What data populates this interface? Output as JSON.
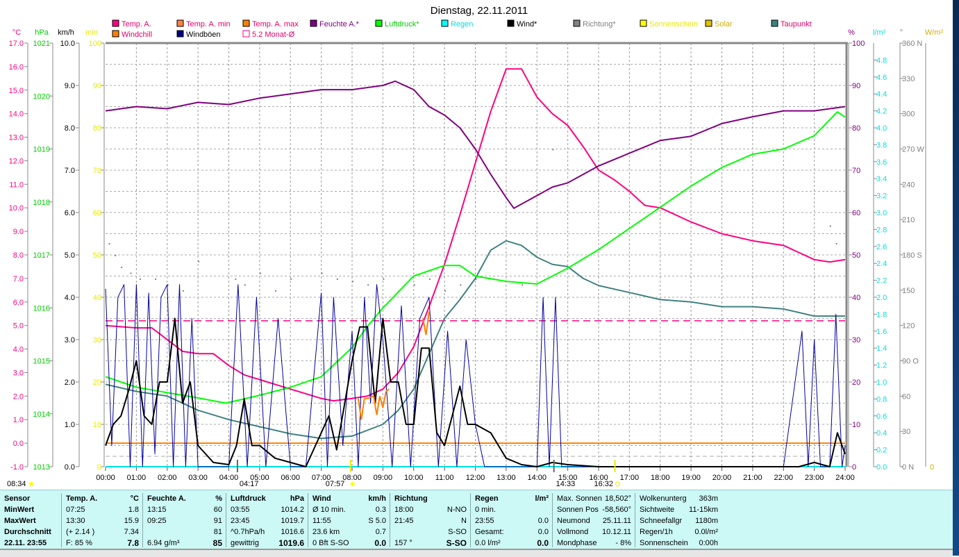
{
  "title": "Dienstag, 22.11.2011",
  "legend": [
    {
      "label": "Temp. A.",
      "color": "#ff0080",
      "text": "#e0006a"
    },
    {
      "label": "Temp. A. min",
      "color": "#ff8040",
      "text": "#e0006a"
    },
    {
      "label": "Temp. A. max",
      "color": "#ff8000",
      "text": "#e0006a"
    },
    {
      "label": "Feuchte A.*",
      "color": "#800080",
      "text": "#800080"
    },
    {
      "label": "Luftdruck*",
      "color": "#00ff00",
      "text": "#00cc00"
    },
    {
      "label": "Regen",
      "color": "#00ffff",
      "text": "#00e0e0"
    },
    {
      "label": "Wind*",
      "color": "#000000",
      "text": "#000000"
    },
    {
      "label": "Richtung*",
      "color": "#808080",
      "text": "#808080"
    },
    {
      "label": "Sonnenschein",
      "color": "#ffff00",
      "text": "#e8e800"
    },
    {
      "label": "Solar",
      "color": "#e0c000",
      "text": "#d0b000"
    },
    {
      "label": "Taupunkt",
      "color": "#408080",
      "text": "#e0006a"
    },
    {
      "label": "Windchill",
      "color": "#ff8000",
      "text": "#e0006a"
    },
    {
      "label": "Windböen",
      "color": "#000080",
      "text": "#000000"
    },
    {
      "label": "5.2 Monat-Ø",
      "color": "#ff0080",
      "text": "#e0006a",
      "outline": true
    }
  ],
  "chart_data": {
    "type": "line",
    "title": "Dienstag, 22.11.2011",
    "x_unit": "hours",
    "xlim": [
      0,
      24
    ],
    "x_ticks": [
      "00:00",
      "01:00",
      "02:00",
      "03:00",
      "04:00",
      "05:00",
      "06:00",
      "07:00",
      "08:00",
      "09:00",
      "10:00",
      "11:00",
      "12:00",
      "13:00",
      "14:00",
      "15:00",
      "16:00",
      "17:00",
      "18:00",
      "19:00",
      "20:00",
      "21:00",
      "22:00",
      "23:00",
      "24:00"
    ],
    "axes": {
      "temp": {
        "unit": "°C",
        "min": -1,
        "max": 17,
        "step": 1,
        "decimals": 1,
        "color": "#ff0080"
      },
      "press": {
        "unit": "hPa",
        "min": 1013,
        "max": 1021,
        "step": 1,
        "decimals": 0,
        "color": "#00cc00"
      },
      "wind": {
        "unit": "km/h",
        "min": 0,
        "max": 10,
        "step": 1,
        "decimals": 1,
        "color": "#000000"
      },
      "sunmin": {
        "unit": "min",
        "min": 0,
        "max": 100,
        "step": 10,
        "decimals": 0,
        "color": "#e8e800"
      },
      "hum": {
        "unit": "%",
        "min": 0,
        "max": 100,
        "step": 10,
        "decimals": 0,
        "color": "#800080"
      },
      "rain": {
        "unit": "l/m²",
        "min": 0,
        "max": 5,
        "step": 0.2,
        "decimals": 1,
        "color": "#00e0e0",
        "skipTop": true
      },
      "dir": {
        "unit": "°",
        "min": 0,
        "max": 360,
        "step": 30,
        "decimals": 0,
        "color": "#808080",
        "suffix": {
          "360": " N",
          "270": " W",
          "180": " S",
          "90": "  O",
          "0": "   N"
        }
      },
      "solar": {
        "unit": "W/m²",
        "min": 0,
        "max": 0,
        "color": "#d0b000"
      }
    },
    "series": [
      {
        "name": "Temp. A.",
        "axis": "temp",
        "color": "#ff0080",
        "width": 2,
        "x": [
          0,
          1,
          1.5,
          2,
          2.5,
          3,
          3.5,
          4,
          4.5,
          5,
          6,
          7,
          7.4,
          8,
          8.5,
          9,
          9.5,
          10,
          10.5,
          11,
          11.5,
          12,
          12.5,
          13,
          13.5,
          14,
          14.5,
          15,
          15.5,
          16,
          16.5,
          17,
          17.5,
          18,
          19,
          20,
          21,
          22,
          23,
          23.5,
          24
        ],
        "y": [
          5.0,
          4.9,
          4.9,
          4.4,
          3.9,
          3.8,
          3.8,
          3.3,
          2.9,
          2.7,
          2.3,
          1.9,
          1.8,
          1.9,
          2.0,
          2.3,
          3.0,
          4.1,
          5.8,
          7.6,
          9.7,
          11.9,
          14.1,
          15.9,
          15.9,
          14.7,
          14.0,
          13.5,
          12.6,
          11.6,
          11.2,
          10.7,
          10.1,
          10.0,
          9.4,
          8.9,
          8.6,
          8.4,
          7.8,
          7.7,
          7.8
        ]
      },
      {
        "name": "Taupunkt",
        "axis": "temp",
        "color": "#408080",
        "width": 2,
        "x": [
          0,
          1,
          2,
          3,
          4,
          5,
          6,
          7,
          8,
          9,
          9.5,
          10,
          10.5,
          11,
          11.5,
          12,
          12.5,
          13,
          13.5,
          14,
          14.5,
          15,
          15.5,
          16,
          17,
          18,
          19,
          20,
          21,
          22,
          23,
          24
        ],
        "y": [
          2.5,
          2.2,
          2.0,
          1.4,
          1.0,
          0.7,
          0.4,
          0.2,
          0.3,
          0.8,
          1.4,
          2.3,
          3.8,
          5.3,
          6.1,
          7.0,
          8.2,
          8.6,
          8.4,
          7.9,
          7.6,
          7.5,
          7.0,
          6.7,
          6.4,
          6.1,
          6.0,
          5.8,
          5.8,
          5.7,
          5.4,
          5.4
        ]
      },
      {
        "name": "Feuchte A.",
        "axis": "hum",
        "color": "#800080",
        "width": 2,
        "x": [
          0,
          1,
          2,
          3,
          4,
          5,
          6,
          7,
          8,
          9,
          9.4,
          10,
          10.5,
          11,
          11.5,
          12,
          12.5,
          13,
          13.25,
          14,
          14.5,
          15,
          16,
          17,
          18,
          19,
          20,
          21,
          22,
          23,
          24
        ],
        "y": [
          84,
          85,
          84.5,
          86,
          85.5,
          87,
          88,
          89,
          89,
          90,
          91,
          89,
          85,
          83,
          80,
          75,
          69,
          63.5,
          61,
          64,
          66,
          67,
          71,
          74,
          77,
          78,
          81,
          82.6,
          84,
          84,
          85
        ]
      },
      {
        "name": "Luftdruck",
        "axis": "press",
        "color": "#00ff00",
        "width": 2,
        "x": [
          0,
          1,
          2,
          3,
          3.9,
          5,
          6,
          7,
          8,
          8.5,
          9,
          10,
          11,
          11.5,
          12,
          13,
          14,
          15,
          16,
          17,
          18,
          19,
          20,
          21,
          22,
          23,
          23.75,
          24
        ],
        "y": [
          1014.7,
          1014.5,
          1014.4,
          1014.3,
          1014.2,
          1014.35,
          1014.5,
          1014.7,
          1015.25,
          1015.65,
          1016.0,
          1016.6,
          1016.8,
          1016.8,
          1016.6,
          1016.5,
          1016.45,
          1016.75,
          1017.1,
          1017.5,
          1017.9,
          1018.3,
          1018.65,
          1018.9,
          1019.0,
          1019.25,
          1019.7,
          1019.6
        ]
      },
      {
        "name": "Windböen",
        "axis": "wind",
        "color": "#0000a0",
        "width": 1,
        "x": [
          0,
          0.2,
          0.4,
          0.6,
          0.8,
          1.0,
          1.2,
          1.4,
          1.6,
          1.8,
          2.0,
          2.2,
          2.4,
          2.6,
          2.8,
          3.0,
          3.5,
          4.0,
          4.3,
          4.6,
          4.9,
          5.2,
          5.6,
          6.0,
          6.5,
          7.0,
          7.2,
          7.4,
          7.7,
          8.0,
          8.2,
          8.4,
          8.6,
          8.8,
          9.0,
          9.3,
          9.6,
          9.9,
          10.2,
          10.5,
          10.8,
          11.1,
          11.4,
          11.7,
          12.0,
          12.3,
          12.6,
          12.9,
          13.5,
          14.0,
          14.2,
          14.4,
          14.6,
          14.8,
          15.0,
          16,
          18,
          20,
          22,
          22.6,
          22.8,
          23.0,
          23.2,
          23.5,
          23.7,
          23.9,
          24
        ],
        "y": [
          4.2,
          0.5,
          4.0,
          4.3,
          0,
          4.3,
          0,
          4.1,
          0.3,
          4.0,
          4.3,
          0,
          4.3,
          0,
          3.5,
          0,
          0,
          0,
          4.3,
          0,
          4.0,
          0,
          3.5,
          0,
          0,
          4.1,
          0,
          4.0,
          0.5,
          3.2,
          0,
          4.0,
          1.5,
          4.3,
          3.0,
          0,
          3.8,
          0,
          3.5,
          4.0,
          0,
          3.2,
          0,
          3.0,
          1.0,
          0,
          0,
          0,
          0,
          0,
          4.0,
          0,
          4.0,
          0,
          0,
          0,
          0,
          0,
          0,
          3.2,
          0,
          3.0,
          0,
          0,
          3.6,
          0,
          0.5
        ]
      },
      {
        "name": "Wind",
        "axis": "wind",
        "color": "#000000",
        "width": 2,
        "x": [
          0,
          0.25,
          0.5,
          0.75,
          1,
          1.25,
          1.5,
          1.75,
          2,
          2.25,
          2.5,
          2.75,
          3,
          3.5,
          4,
          4.25,
          4.5,
          4.75,
          5,
          5.5,
          6,
          6.5,
          7,
          7.25,
          7.5,
          8,
          8.25,
          8.5,
          8.75,
          9,
          9.25,
          9.5,
          9.75,
          10,
          10.25,
          10.5,
          10.75,
          11,
          11.5,
          11.75,
          12,
          12.5,
          13,
          13.5,
          14,
          14.5,
          15,
          16,
          20,
          22.5,
          23,
          23.5,
          23.75,
          24
        ],
        "y": [
          0.5,
          1.0,
          1.2,
          1.8,
          2.5,
          1.2,
          1.0,
          2.0,
          2.0,
          3.5,
          1.5,
          2.0,
          0.5,
          0.1,
          0.05,
          0.5,
          1.6,
          0.5,
          0.5,
          0.2,
          0.1,
          0.0,
          0.8,
          1.2,
          0.4,
          2.5,
          3.3,
          3.3,
          1.5,
          3.5,
          2.0,
          2.0,
          1.0,
          1.0,
          2.8,
          2.8,
          0.8,
          0.5,
          1.9,
          1.0,
          1.0,
          0.8,
          0.2,
          0.05,
          0.0,
          0.1,
          0.05,
          0.0,
          0.0,
          0.0,
          0.1,
          0.0,
          0.8,
          0.3
        ]
      },
      {
        "name": "Windchill",
        "axis": "temp",
        "color": "#ff8000",
        "width": 2,
        "x": [
          8.2,
          8.3,
          8.4,
          8.5,
          8.7,
          8.8,
          8.9,
          9.0,
          9.1,
          9.2,
          10.3,
          10.4,
          10.5
        ],
        "y": [
          1.9,
          1.0,
          1.9,
          1.9,
          2.0,
          1.2,
          2.0,
          1.5,
          2.2,
          2.3,
          5.3,
          4.6,
          5.6
        ]
      }
    ],
    "direction_points": {
      "axis": "dir",
      "color": "#808080",
      "x": [
        0.1,
        0.3,
        0.5,
        0.8,
        1.1,
        1.6,
        2.0,
        2.5,
        3.0,
        4.2,
        4.5,
        5.0,
        5.5,
        6.0,
        7.0,
        7.5,
        8.0,
        8.5,
        9.0,
        9.5,
        10.0,
        10.5,
        11.0,
        11.5,
        12.0,
        13.5,
        14.5,
        23.5,
        23.7
      ],
      "y": [
        190,
        180,
        170,
        165,
        160,
        160,
        155,
        150,
        175,
        160,
        155,
        165,
        150,
        160,
        165,
        160,
        158,
        155,
        160,
        150,
        155,
        160,
        150,
        155,
        160,
        155,
        270,
        205,
        190
      ]
    },
    "reference_lines": [
      {
        "label": "5.2 Monat-Ø",
        "axis": "temp",
        "value": 5.2,
        "color": "#ff0080",
        "dashed": true
      },
      {
        "label": "0 °C",
        "axis": "temp",
        "value": 0,
        "color": "#ff8000",
        "dashed": false
      }
    ],
    "sun_moon": {
      "day_length": "08:34",
      "moonrise": "04:17",
      "sunrise": "07:57",
      "moonset": "14:33",
      "sunset": "16:32",
      "sunrise_h": 7.95,
      "sunset_h": 16.53,
      "moonrise_h": 4.28,
      "moonset_h": 14.55
    }
  },
  "table": {
    "cols": [
      {
        "rows": [
          [
            "Sensor",
            ""
          ],
          [
            "MinWert",
            ""
          ],
          [
            "MaxWert",
            ""
          ],
          [
            "Durchschnitt",
            ""
          ],
          [
            "22.11. 23:55",
            ""
          ]
        ],
        "bold": [
          true,
          true,
          true,
          true,
          true
        ]
      },
      {
        "rows": [
          [
            "Temp. A.",
            "°C"
          ],
          [
            "07:25",
            "1.8"
          ],
          [
            "13:30",
            "15.9"
          ],
          [
            "(+ 2.14 )",
            "7.34"
          ],
          [
            "F: 85 %",
            "7.8"
          ]
        ]
      },
      {
        "rows": [
          [
            "Feuchte A.",
            "%"
          ],
          [
            "13:15",
            "60"
          ],
          [
            "09:25",
            "91"
          ],
          [
            "",
            "81"
          ],
          [
            "6.94 g/m³",
            "85"
          ]
        ]
      },
      {
        "rows": [
          [
            "Luftdruck",
            "hPa"
          ],
          [
            "03:55",
            "1014.2"
          ],
          [
            "23:45",
            "1019.7"
          ],
          [
            "^0.7hPa/h",
            "1016.6"
          ],
          [
            "gewittrig",
            "1019.6"
          ]
        ]
      },
      {
        "rows": [
          [
            "Wind",
            "km/h"
          ],
          [
            "Ø 10 min.",
            "0.3"
          ],
          [
            "11:55",
            "S 5.0"
          ],
          [
            "23.6 km",
            "0.7"
          ],
          [
            "0 Bft S-SO",
            "0.0"
          ]
        ]
      },
      {
        "rows": [
          [
            "Richtung",
            ""
          ],
          [
            "18:00",
            "N-NO"
          ],
          [
            "21:45",
            "N"
          ],
          [
            "",
            "S-SO"
          ],
          [
            "157 °",
            "S-SO"
          ]
        ]
      },
      {
        "rows": [
          [
            "Regen",
            "l/m²"
          ],
          [
            "0 min.",
            ""
          ],
          [
            "23:55",
            "0.0"
          ],
          [
            "Gesamt:",
            "0.0"
          ],
          [
            "0.0 l/m²",
            "0.0"
          ]
        ]
      },
      {
        "rows": [
          [
            "Max. Sonnen",
            "18,502°"
          ],
          [
            "Sonnen Pos",
            "-58,560°"
          ],
          [
            "Neumond",
            "25.11.11"
          ],
          [
            "Vollmond",
            "10.12.11"
          ],
          [
            "Mondphase",
            "- 8%"
          ]
        ],
        "plain": true
      },
      {
        "rows": [
          [
            "Wolkenunterg",
            "363m"
          ],
          [
            "Sichtweite",
            "11-15km"
          ],
          [
            "Schneefallgr",
            "1180m"
          ],
          [
            "Regen/1h",
            "0.0l/m²"
          ],
          [
            "Sonnenschein",
            "0:00h"
          ]
        ],
        "plain": true
      }
    ]
  }
}
